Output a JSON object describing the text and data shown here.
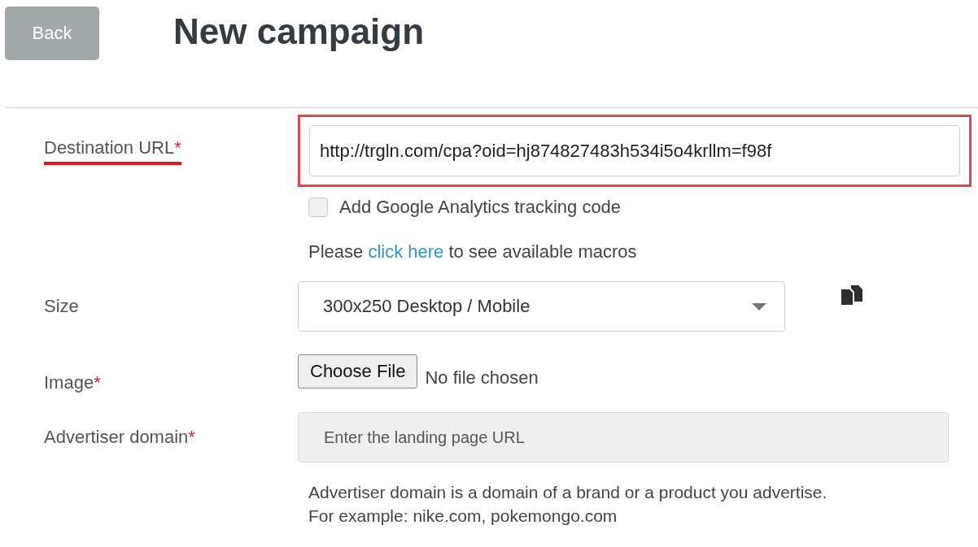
{
  "back_button": {
    "label": "Back"
  },
  "title": "New campaign",
  "fields": [
    {
      "kind": "text",
      "label": "Destination URL",
      "marker": "*",
      "annotated": true,
      "value": "http://trgln.com/cpa?oid=hj874827483h534i5o4krllm=f98f"
    },
    {
      "kind": "checkbox",
      "label": "Add Google Analytics tracking code",
      "checked": false
    },
    {
      "kind": "note",
      "before": "Please",
      "link": "click here",
      "after": "to see available macros"
    },
    {
      "kind": "select",
      "label": "Size",
      "value": "300x250 Desktop / Mobile"
    },
    {
      "kind": "file",
      "label": "Image",
      "marker": "*",
      "button": "Choose File",
      "status": "No file chosen"
    },
    {
      "kind": "input",
      "label": "Advertiser domain",
      "marker": "*",
      "placeholder": "Enter the landing page URL",
      "help": [
        "Advertiser domain is a domain of a brand or a product you advertise.",
        "For example: nike.com, pokemongo.com"
      ]
    }
  ]
}
